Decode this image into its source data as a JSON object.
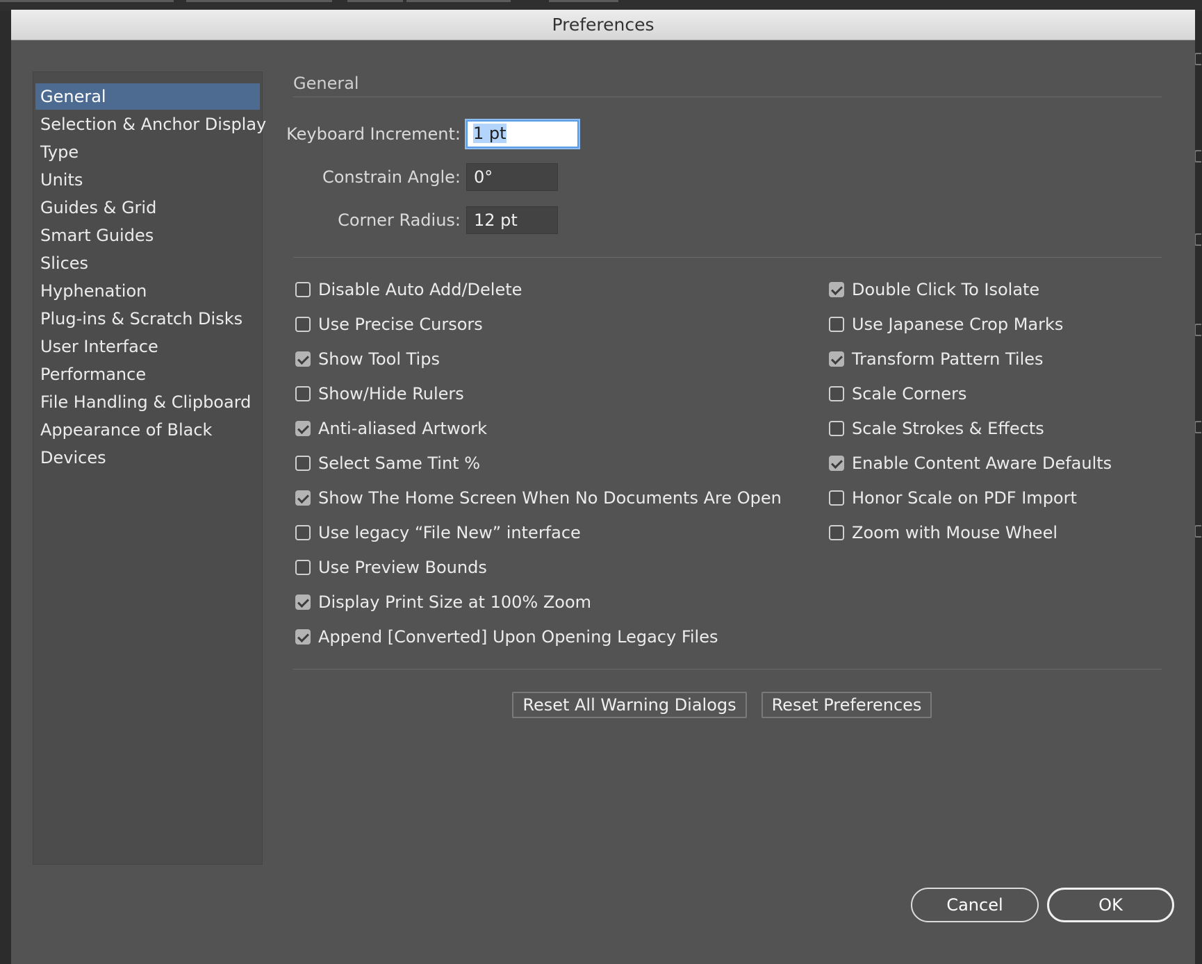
{
  "window": {
    "title": "Preferences"
  },
  "sidebar": {
    "items": [
      {
        "label": "General",
        "selected": true
      },
      {
        "label": "Selection & Anchor Display"
      },
      {
        "label": "Type"
      },
      {
        "label": "Units"
      },
      {
        "label": "Guides & Grid"
      },
      {
        "label": "Smart Guides"
      },
      {
        "label": "Slices"
      },
      {
        "label": "Hyphenation"
      },
      {
        "label": "Plug-ins & Scratch Disks"
      },
      {
        "label": "User Interface"
      },
      {
        "label": "Performance"
      },
      {
        "label": "File Handling & Clipboard"
      },
      {
        "label": "Appearance of Black"
      },
      {
        "label": "Devices"
      }
    ]
  },
  "main": {
    "section_title": "General",
    "fields": {
      "keyboard_increment": {
        "label": "Keyboard Increment:",
        "value": "1 pt"
      },
      "constrain_angle": {
        "label": "Constrain Angle:",
        "value": "0°"
      },
      "corner_radius": {
        "label": "Corner Radius:",
        "value": "12 pt"
      }
    },
    "options_left": [
      {
        "label": "Disable Auto Add/Delete",
        "checked": false
      },
      {
        "label": "Use Precise Cursors",
        "checked": false
      },
      {
        "label": "Show Tool Tips",
        "checked": true
      },
      {
        "label": "Show/Hide Rulers",
        "checked": false
      },
      {
        "label": "Anti-aliased Artwork",
        "checked": true
      },
      {
        "label": "Select Same Tint %",
        "checked": false
      },
      {
        "label": "Show The Home Screen When No Documents Are Open",
        "checked": true
      },
      {
        "label": "Use legacy “File New” interface",
        "checked": false
      },
      {
        "label": "Use Preview Bounds",
        "checked": false
      },
      {
        "label": "Display Print Size at 100% Zoom",
        "checked": true
      },
      {
        "label": "Append [Converted] Upon Opening Legacy Files",
        "checked": true
      }
    ],
    "options_right": [
      {
        "label": "Double Click To Isolate",
        "checked": true
      },
      {
        "label": "Use Japanese Crop Marks",
        "checked": false
      },
      {
        "label": "Transform Pattern Tiles",
        "checked": true
      },
      {
        "label": "Scale Corners",
        "checked": false
      },
      {
        "label": "Scale Strokes & Effects",
        "checked": false
      },
      {
        "label": "Enable Content Aware Defaults",
        "checked": true
      },
      {
        "label": "Honor Scale on PDF Import",
        "checked": false
      },
      {
        "label": "Zoom with Mouse Wheel",
        "checked": false
      }
    ],
    "reset_warnings_label": "Reset All Warning Dialogs",
    "reset_prefs_label": "Reset Preferences"
  },
  "footer": {
    "cancel_label": "Cancel",
    "ok_label": "OK"
  },
  "colors": {
    "dialog_bg": "#535353",
    "selection": "#4d6a90",
    "focus": "#5a9be6"
  }
}
